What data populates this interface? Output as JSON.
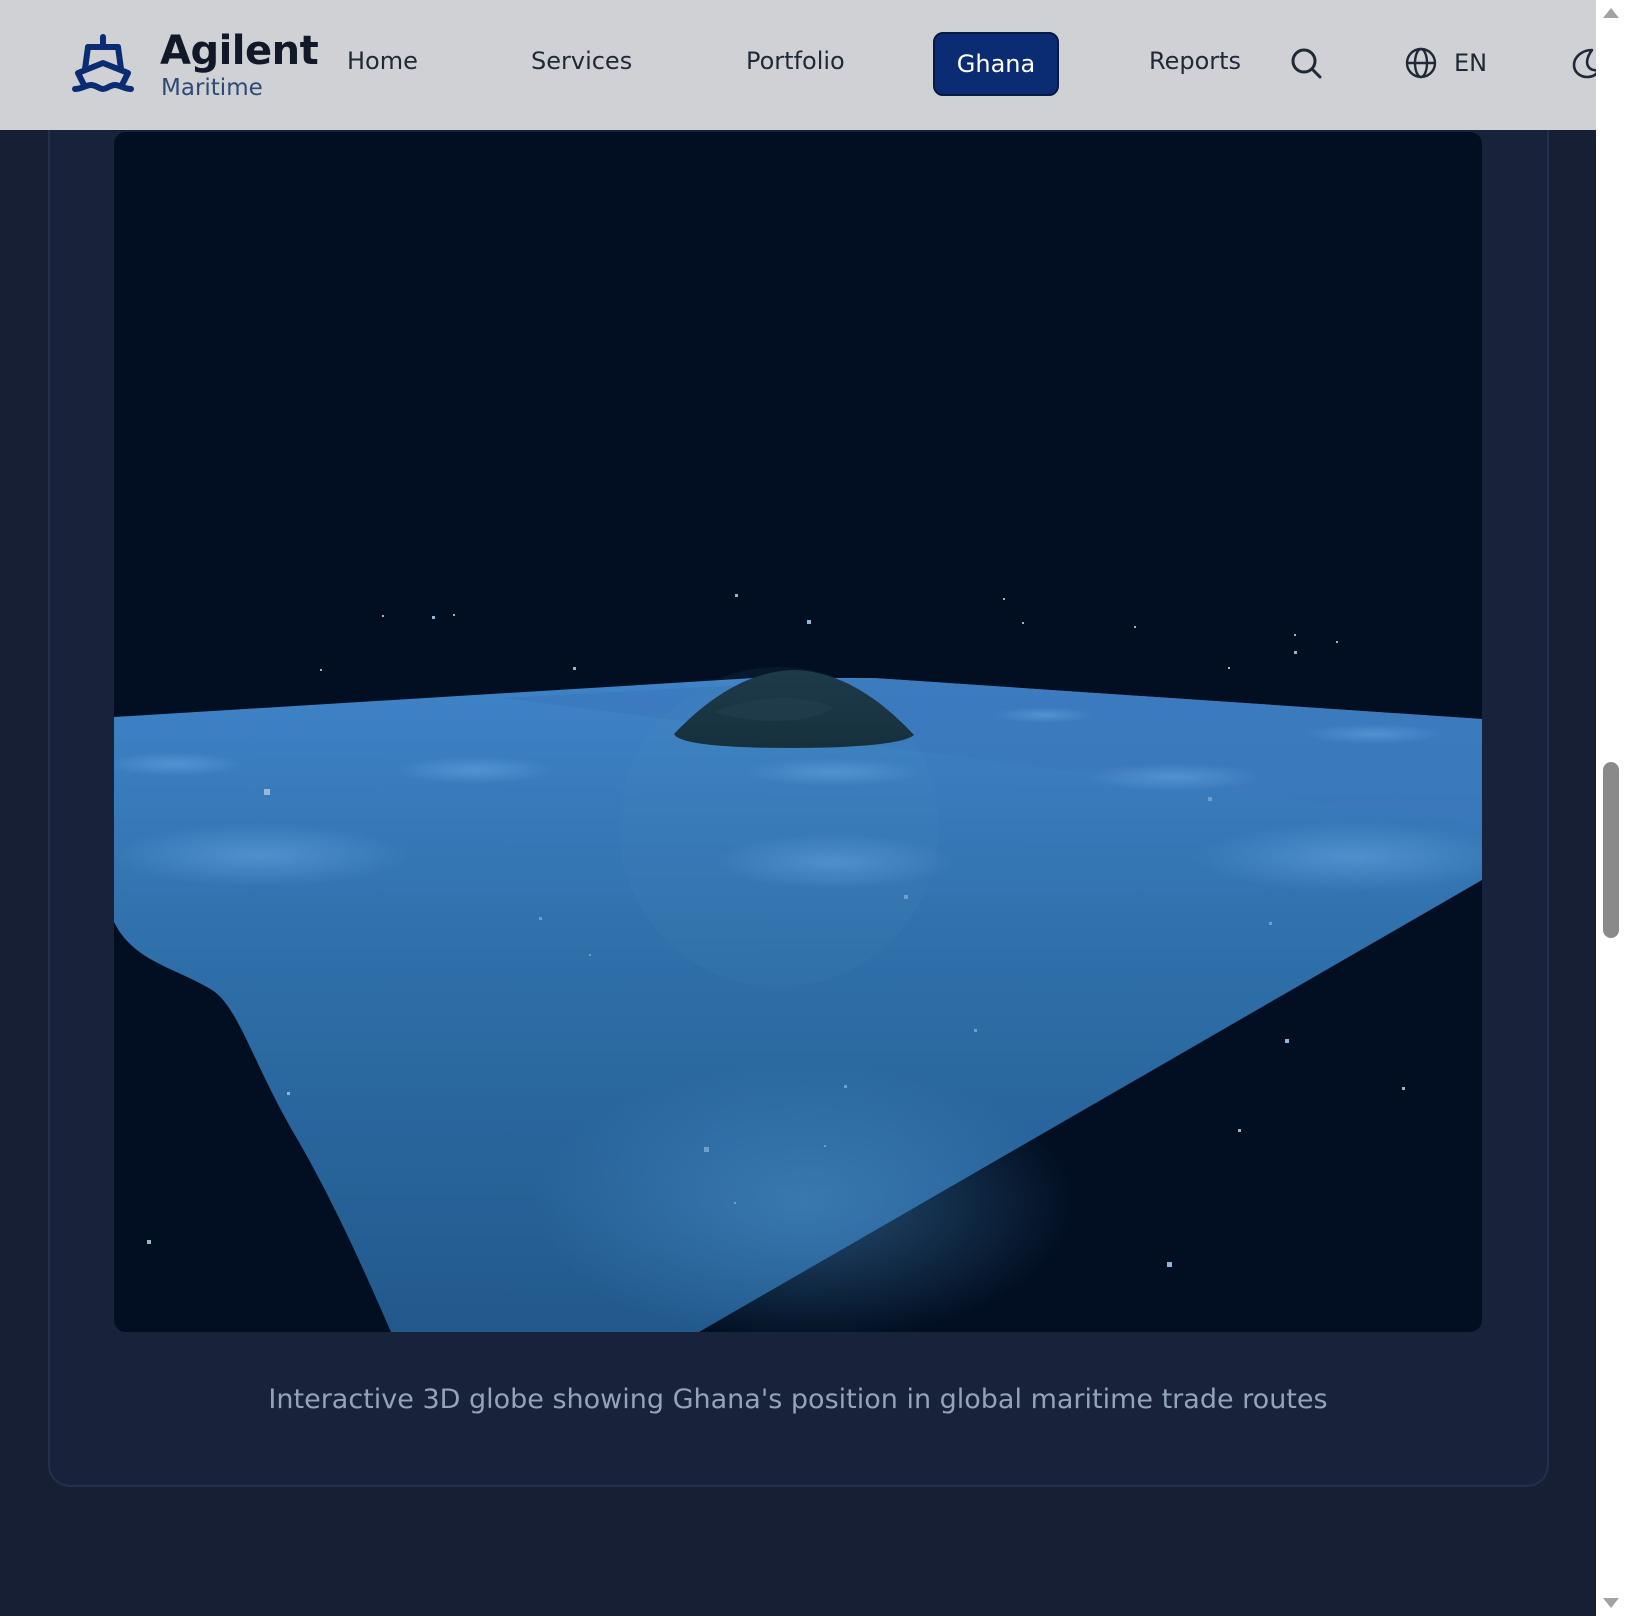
{
  "header": {
    "brand_name": "Agilent",
    "brand_sub": "Maritime",
    "nav": {
      "home": "Home",
      "services": "Services",
      "portfolio": "Portfolio",
      "ghana": "Ghana",
      "reports": "Reports"
    },
    "active_nav": "Ghana",
    "language": "EN",
    "colors": {
      "header_bg": "#cfd1d5",
      "active_bg": "#0b2c73",
      "page_bg": "#161f33"
    },
    "icons": [
      "ship-logo-icon",
      "search-icon",
      "globe-icon",
      "moon-icon"
    ]
  },
  "main": {
    "caption": "Interactive 3D globe showing Ghana's position in global maritime trade routes"
  }
}
